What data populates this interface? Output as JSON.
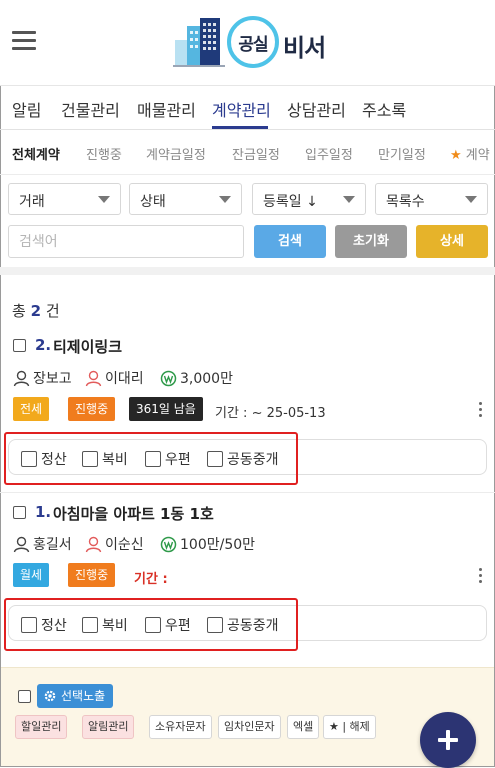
{
  "app": {
    "logo_badge": "공실",
    "logo_text": "비서"
  },
  "main_tabs": [
    {
      "label": "알림"
    },
    {
      "label": "건물관리"
    },
    {
      "label": "매물관리"
    },
    {
      "label": "계약관리"
    },
    {
      "label": "상담관리"
    },
    {
      "label": "주소록"
    }
  ],
  "active_main_tab": "계약관리",
  "sub_tabs": [
    {
      "label": "전체계약"
    },
    {
      "label": "진행중"
    },
    {
      "label": "계약금일정"
    },
    {
      "label": "잔금일정"
    },
    {
      "label": "입주일정"
    },
    {
      "label": "만기일정"
    },
    {
      "label": "계약"
    }
  ],
  "filters": {
    "deal": "거래",
    "status": "상태",
    "sort": "등록일 ↓",
    "page_size": "목록수",
    "search_placeholder": "검색어",
    "search_btn": "검색",
    "reset_btn": "초기화",
    "detail_btn": "상세"
  },
  "summary": {
    "prefix": "총",
    "count": "2",
    "suffix": "건"
  },
  "contracts": [
    {
      "number": "2.",
      "title": "티제이링크",
      "agent": "장보고",
      "manager": "이대리",
      "amount": "3,000만",
      "badges": [
        "전세",
        "진행중",
        "361일 남음"
      ],
      "period": "기간 : ~ 25-05-13",
      "checks": [
        "정산",
        "복비",
        "우편",
        "공동중개"
      ]
    },
    {
      "number": "1.",
      "title": "아침마을 아파트 1동 1호",
      "agent": "홍길서",
      "manager": "이순신",
      "amount": "100만/50만",
      "badges": [
        "월세",
        "진행중"
      ],
      "period": "기간 :",
      "checks": [
        "정산",
        "복비",
        "우편",
        "공동중개"
      ]
    }
  ],
  "bottom": {
    "select_expose": "선택노출",
    "chips": [
      "할일관리",
      "알림관리",
      "소유자문자",
      "임차인문자",
      "엑셀",
      "★ | 해제"
    ]
  },
  "colors": {
    "accent": "#2b3b8f",
    "search": "#5aa9e6",
    "reset": "#9a9a9a",
    "detail": "#e6b32a",
    "jeonse": "#f2a91c",
    "wolse": "#33a8e0",
    "progress": "#f07c1e",
    "dday": "#262626",
    "highlight": "#e02020",
    "fab": "#2c3473"
  }
}
